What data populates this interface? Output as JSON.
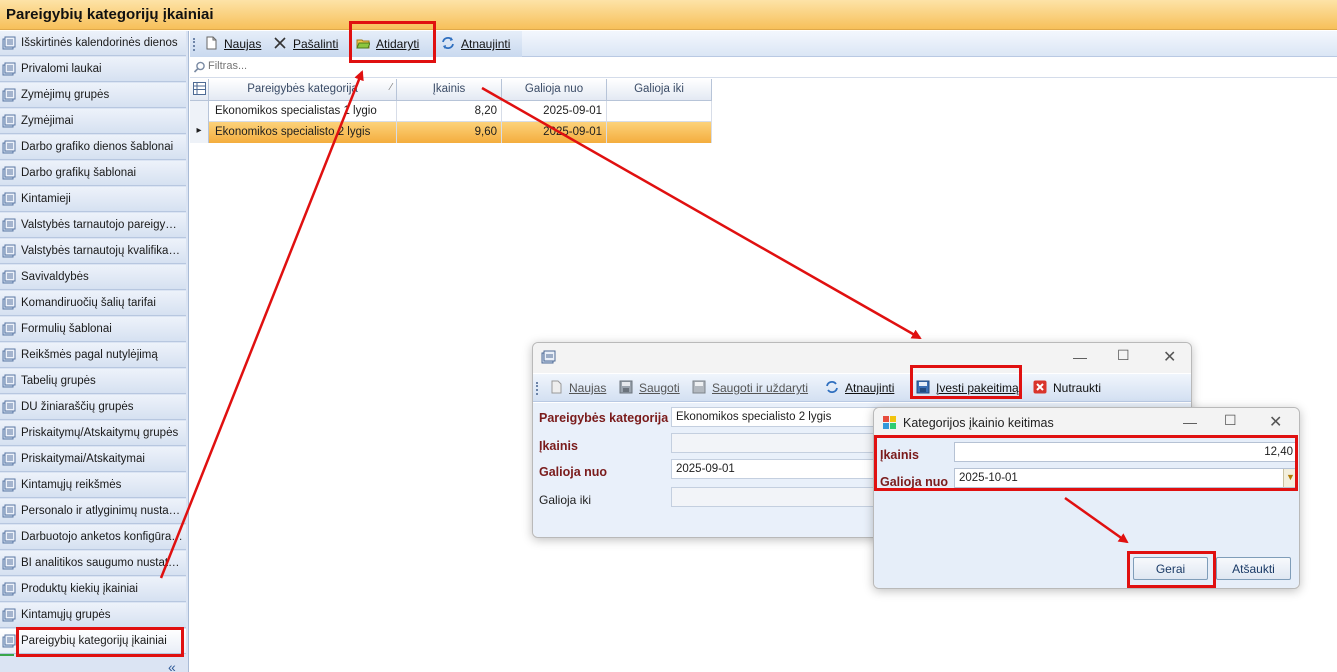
{
  "app": {
    "title": "Pareigybių kategorijų įkainiai"
  },
  "sidebar": {
    "items": [
      "Išskirtinės kalendorinės dienos",
      "Privalomi laukai",
      "Žymėjimų grupės",
      "Žymėjimai",
      "Darbo grafiko dienos šablonai",
      "Darbo grafikų šablonai",
      "Kintamieji",
      "Valstybės tarnautojo pareigybės",
      "Valstybės tarnautojų kvalifikacinės",
      "Savivaldybės",
      "Komandiruočių šalių tarifai",
      "Formulių šablonai",
      "Reikšmės pagal nutylėjimą",
      "Tabelių grupės",
      "DU žiniaraščių grupės",
      "Priskaitymų/Atskaitymų grupės",
      "Priskaitymai/Atskaitymai",
      "Kintamųjų reikšmės",
      "Personalo ir atlyginimų nustatymai",
      "Darbuotojo anketos konfigūracija",
      "BI analitikos saugumo nustatymai",
      "Produktų kiekių įkainiai",
      "Kintamųjų grupės",
      "Pareigybių kategorijų įkainiai"
    ],
    "selected_index": 23,
    "collapse": "«"
  },
  "toolbar": {
    "new": "Naujas",
    "delete": "Pašalinti",
    "open": "Atidaryti",
    "refresh": "Atnaujinti"
  },
  "filter": {
    "placeholder": "Filtras..."
  },
  "grid": {
    "columns": [
      "Pareigybės kategorija",
      "Įkainis",
      "Galioja nuo",
      "Galioja iki"
    ],
    "rows": [
      [
        "Ekonomikos specialistas 1 lygio",
        "8,20",
        "2025-09-01",
        ""
      ],
      [
        "Ekonomikos specialisto 2 lygis",
        "9,60",
        "2025-09-01",
        ""
      ]
    ],
    "selected_row": 1,
    "row_indicator": "▸"
  },
  "edit_window": {
    "toolbar": {
      "new": "Naujas",
      "save": "Saugoti",
      "save_close": "Saugoti ir uždaryti",
      "refresh": "Atnaujinti",
      "enter_change": "Įvesti pakeitimą",
      "abort": "Nutraukti"
    },
    "fields": {
      "category_label": "Pareigybės kategorija",
      "category_value": "Ekonomikos specialisto 2 lygis",
      "price_label": "Įkainis",
      "price_value": "",
      "from_label": "Galioja nuo",
      "from_value": "2025-09-01",
      "to_label": "Galioja iki",
      "to_value": ""
    }
  },
  "change_dialog": {
    "title": "Kategorijos įkainio keitimas",
    "price_label": "Įkainis",
    "price_value": "12,40",
    "from_label": "Galioja nuo",
    "from_value": "2025-10-01",
    "ok": "Gerai",
    "cancel": "Atšaukti"
  },
  "colors": {
    "highlight": "#e01010",
    "selection": "#f4ad3e",
    "title_bar": "#f7c05a"
  }
}
